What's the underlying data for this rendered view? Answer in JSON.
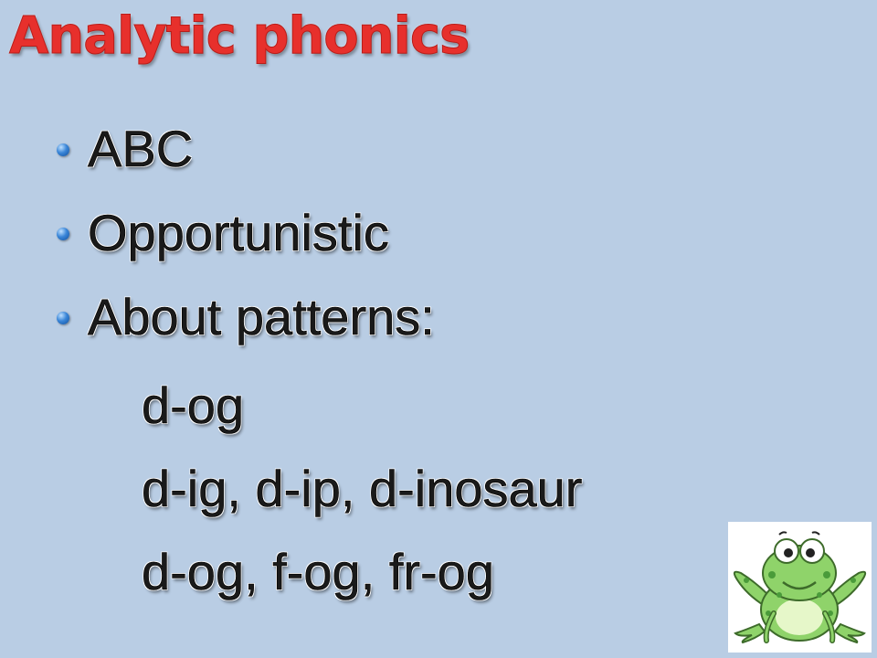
{
  "slide": {
    "title": "Analytic phonics",
    "bullets": [
      {
        "text": "ABC"
      },
      {
        "text": "Opportunistic"
      },
      {
        "text": "About patterns:"
      }
    ],
    "sub_lines": [
      {
        "text": "d-og"
      },
      {
        "text": "d-ig, d-ip, d-inosaur"
      },
      {
        "text": "d-og, f-og, fr-og"
      }
    ],
    "colors": {
      "background": "#b9cde4",
      "title": "#e7302c",
      "bullet": "#3a86d8",
      "frog": "#8fd36a"
    },
    "image": {
      "icon": "frog-icon"
    }
  }
}
